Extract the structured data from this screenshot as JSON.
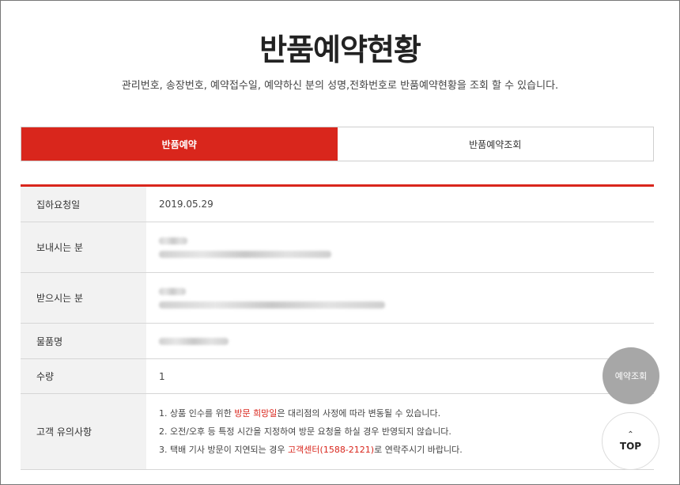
{
  "page": {
    "title": "반품예약현황",
    "subtitle": "관리번호, 송장번호, 예약접수일, 예약하신 분의 성명,전화번호로 반품예약현황을 조회 할 수 있습니다."
  },
  "tabs": [
    {
      "label": "반품예약",
      "active": true
    },
    {
      "label": "반품예약조회",
      "active": false
    }
  ],
  "rows": {
    "pickup_date": {
      "label": "집하요청일",
      "value": "2019.05.29"
    },
    "sender": {
      "label": "보내시는 분"
    },
    "receiver": {
      "label": "받으시는 분"
    },
    "item": {
      "label": "물품명"
    },
    "quantity": {
      "label": "수량",
      "value": "1"
    },
    "notice": {
      "label": "고객 유의사항",
      "line1_pre": "1. 상품 인수를 위한 ",
      "line1_highlight": "방문 희망일",
      "line1_post": "은 대리점의 사정에 따라 변동될 수 있습니다.",
      "line2": "2. 오전/오후 등 특정 시간을 지정하여 방문 요청을 하실 경우 반영되지 않습니다.",
      "line3_pre": "3. 택배 기사 방문이 지연되는 경우 ",
      "line3_highlight": "고객센터(1588-2121)",
      "line3_post": "로 연락주시기 바랍니다."
    }
  },
  "floating": {
    "reserve_label": "예약조회",
    "top_label": "TOP"
  },
  "colors": {
    "accent": "#d9261c",
    "header_cell": "#f2f2f2"
  }
}
